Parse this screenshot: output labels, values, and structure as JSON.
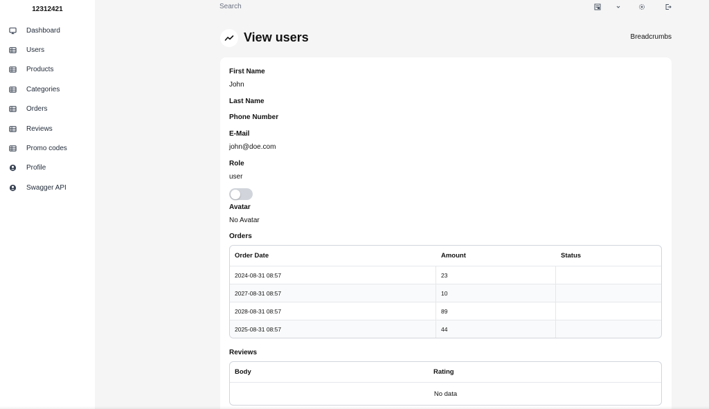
{
  "app": {
    "brand": "12312421"
  },
  "sidebar": {
    "items": [
      {
        "label": "Dashboard",
        "icon": "monitor-icon"
      },
      {
        "label": "Users",
        "icon": "table-icon"
      },
      {
        "label": "Products",
        "icon": "table-icon"
      },
      {
        "label": "Categories",
        "icon": "table-icon"
      },
      {
        "label": "Orders",
        "icon": "table-icon"
      },
      {
        "label": "Reviews",
        "icon": "table-icon"
      },
      {
        "label": "Promo codes",
        "icon": "table-icon"
      },
      {
        "label": "Profile",
        "icon": "user-circle-icon"
      },
      {
        "label": "Swagger API",
        "icon": "user-circle-icon"
      }
    ]
  },
  "topbar": {
    "search_label": "Search",
    "icons": [
      "language-icon",
      "chevron-down-icon",
      "theme-icon",
      "logout-icon"
    ]
  },
  "page": {
    "title": "View users",
    "title_icon": "trend-icon",
    "breadcrumbs": "Breadcrumbs"
  },
  "user": {
    "first_name_label": "First Name",
    "first_name": "John",
    "last_name_label": "Last Name",
    "phone_label": "Phone Number",
    "email_label": "E-Mail",
    "email": "john@doe.com",
    "role_label": "Role",
    "role": "user",
    "toggle_on": false,
    "avatar_label": "Avatar",
    "avatar": "No Avatar"
  },
  "orders": {
    "title": "Orders",
    "columns": [
      "Order Date",
      "Amount",
      "Status"
    ],
    "rows": [
      {
        "date": "2024-08-31 08:57",
        "amount": "23",
        "status": ""
      },
      {
        "date": "2027-08-31 08:57",
        "amount": "10",
        "status": ""
      },
      {
        "date": "2028-08-31 08:57",
        "amount": "89",
        "status": ""
      },
      {
        "date": "2025-08-31 08:57",
        "amount": "44",
        "status": ""
      }
    ]
  },
  "reviews": {
    "title": "Reviews",
    "columns": [
      "Body",
      "Rating"
    ],
    "empty_text": "No data"
  }
}
